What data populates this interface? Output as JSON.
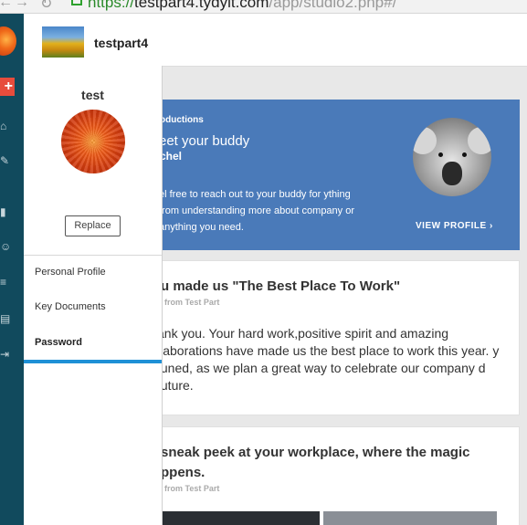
{
  "browser": {
    "url_scheme": "https://",
    "url_host": "testpart4.tydyit.com",
    "url_path": "/app/studio2.php#/"
  },
  "header": {
    "name": "testpart4"
  },
  "rail": {
    "plus_label": "+"
  },
  "profile": {
    "username": "test",
    "replace_label": "Replace",
    "menu": [
      {
        "label": "Personal Profile"
      },
      {
        "label": "Key Documents"
      },
      {
        "label": "Password"
      }
    ]
  },
  "intro_card": {
    "eyebrow": "oductions",
    "heading": "eet your buddy",
    "subhead": "chel",
    "body": "el free to reach out to your buddy for ything from understanding more about company or anything you need.",
    "view_profile": "VIEW PROFILE",
    "view_profile_arrow": "›"
  },
  "posts": [
    {
      "title": "u made us \"The Best Place To Work\"",
      "from": "from Test Part",
      "text": "ank you. Your hard work,positive spirit and amazing llaborations have made us the best place to work this year. y tuned, as we plan a great way to celebrate our company d future."
    },
    {
      "title": "sneak peek at your workplace, where the magic ppens.",
      "from": "from Test Part"
    }
  ],
  "colors": {
    "rail": "#114a5d",
    "accent": "#1e90d6",
    "intro_card": "#4a7ab9"
  }
}
